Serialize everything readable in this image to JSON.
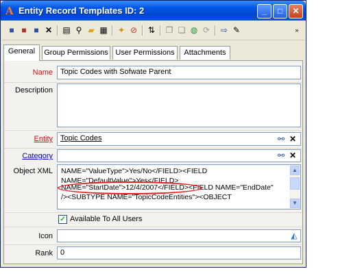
{
  "window": {
    "title": "Entity Record Templates ID: 2"
  },
  "toolbar": {
    "icons": [
      "save-icon",
      "save-close-icon",
      "save-new-icon",
      "delete-icon",
      "print-icon",
      "find-icon",
      "open-folder-icon",
      "list-icon",
      "magic-icon",
      "remove-icon",
      "sort-icon",
      "copy-icon",
      "paste-icon",
      "globe-icon",
      "refresh-icon",
      "import-icon",
      "note-icon"
    ]
  },
  "tabs": [
    {
      "label": "General"
    },
    {
      "label": "Group Permissions"
    },
    {
      "label": "User Permissions"
    },
    {
      "label": "Attachments"
    }
  ],
  "form": {
    "name_label": "Name",
    "name_value": "Topic Codes with Sofwate Parent",
    "description_label": "Description",
    "description_value": "",
    "entity_label": "Entity",
    "entity_value": "Topic Codes",
    "category_label": "Category",
    "category_value": "",
    "object_xml_label": "Object XML",
    "object_xml_lines": [
      "NAME=\"ValueType\">Yes/No</FIELD><FIELD",
      "NAME=\"DefaultValue\">Yes</FIELD>",
      "NAME=\"StartDate\">12/4/2007</FIELD><FIELD NAME=\"EndDate\"",
      "/><SUBTYPE NAME=\"TopicCodeEntities\"><OBJECT"
    ],
    "available_label": "Available To All Users",
    "available_checked": true,
    "icon_label": "Icon",
    "icon_value": "",
    "rank_label": "Rank",
    "rank_value": "0"
  },
  "colors": {
    "required_label": "#c81414",
    "highlight_ellipse": "#e21b1b",
    "title_bar": "#0058e6"
  }
}
